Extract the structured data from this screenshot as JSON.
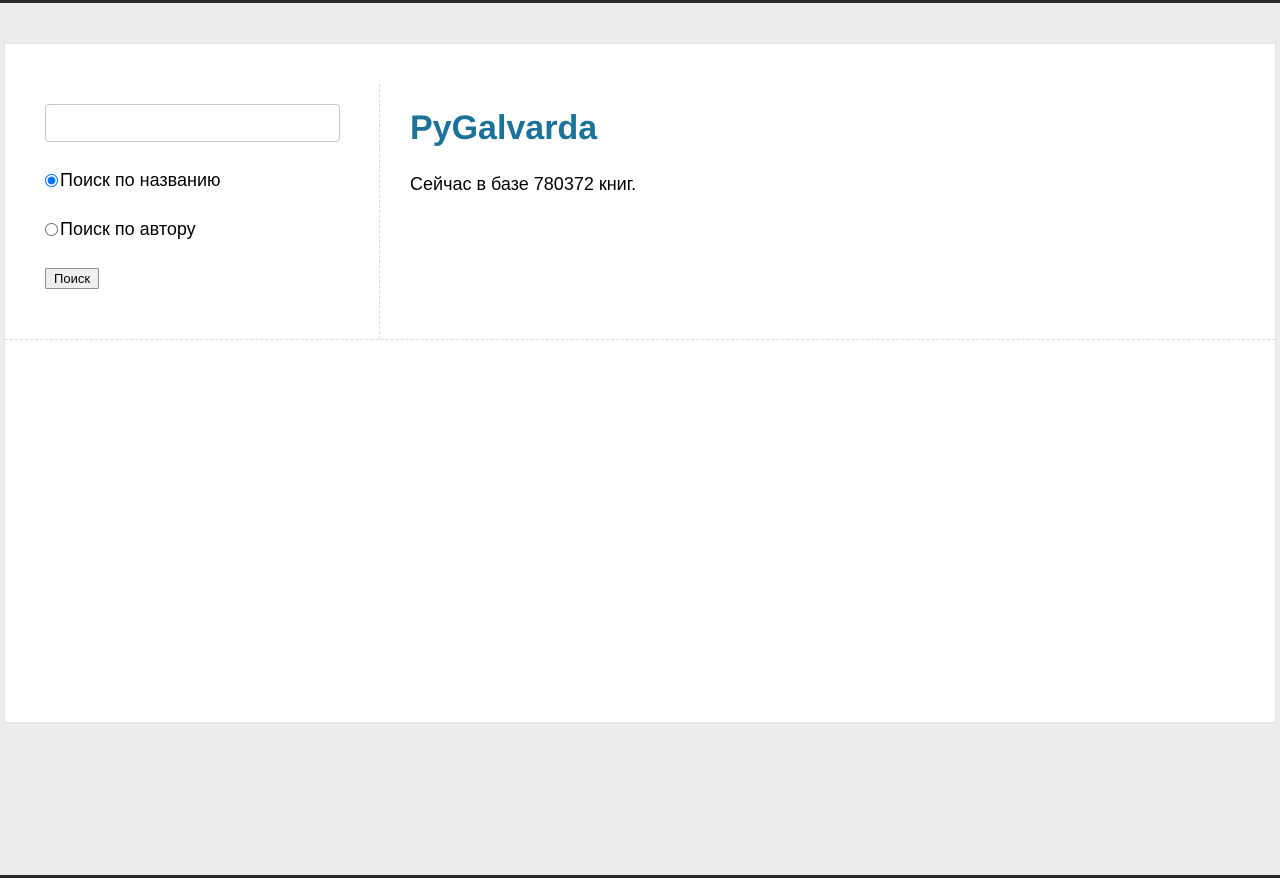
{
  "sidebar": {
    "search_value": "",
    "search_placeholder": "",
    "radio_title_label": "Поиск по названию",
    "radio_author_label": "Поиск по автору",
    "search_button_label": "Поиск"
  },
  "main": {
    "title": "PyGalvarda",
    "status_text": "Сейчас в базе 780372 книг."
  }
}
